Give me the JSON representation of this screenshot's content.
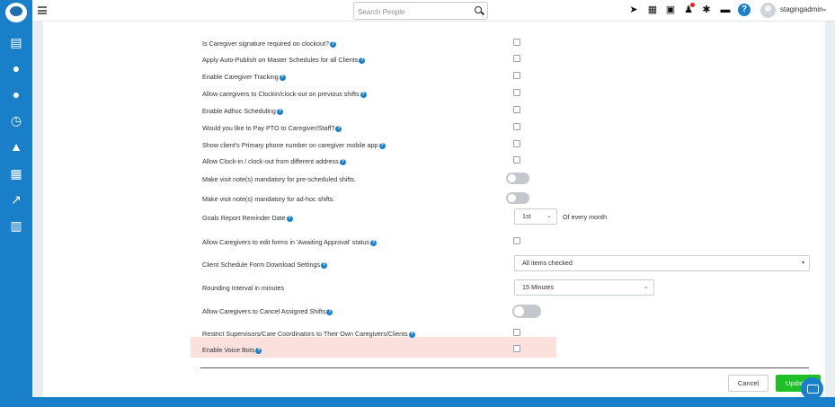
{
  "search": {
    "placeholder": "Search People"
  },
  "header": {
    "username": "stagingadmin",
    "icons": [
      "rocket-icon",
      "calendar-icon",
      "document-icon",
      "bell-icon",
      "gear-icon",
      "chat-bubble-icon",
      "help-icon"
    ]
  },
  "sidebar": {
    "icons": [
      "dashboard-icon",
      "caregiver-icon",
      "client-icon",
      "clock-icon",
      "team-icon",
      "report-icon",
      "chart-icon",
      "billing-icon"
    ]
  },
  "settings": {
    "rows": [
      {
        "label": "Is Caregiver signature required on clockout?",
        "control": "checkbox"
      },
      {
        "label": "Apply Auto-Publish on Master Schedules for all Clients",
        "control": "checkbox"
      },
      {
        "label": "Enable Caregiver Tracking",
        "control": "checkbox"
      },
      {
        "label": "Allow caregivers to Clockin/clock-out on previous shifts",
        "control": "checkbox"
      },
      {
        "label": "Enable Adhoc Scheduling",
        "control": "checkbox"
      },
      {
        "label": "Would you like to Pay PTO to Caregiver/Staff?",
        "control": "checkbox"
      },
      {
        "label": "Show client's Primary phone number on caregiver mobile app",
        "control": "checkbox"
      },
      {
        "label": "Allow Clock-in / clock-out from different address",
        "control": "checkbox"
      },
      {
        "label": "Make visit note(s) mandatory for pre-scheduled shifts.",
        "control": "toggle"
      },
      {
        "label": "Make visit note(s) mandatory for ad-hoc shifts.",
        "control": "toggle"
      },
      {
        "label": "Goals Report Reminder Date",
        "control": "select"
      },
      {
        "label": "Allow Caregivers to edit forms in 'Awaiting Approval' status",
        "control": "checkbox"
      },
      {
        "label": "Client Schedule Form Download Settings",
        "control": "select"
      },
      {
        "label": "Rounding Interval in minutes",
        "control": "select"
      },
      {
        "label": "Allow Caregivers to Cancel Assigned Shifts",
        "control": "toggle"
      },
      {
        "label": "Restrict Supervisors/Care Coordinators to Their Own Caregivers/Clients",
        "control": "checkbox"
      },
      {
        "label": "Enable Voice Bots",
        "control": "checkbox"
      }
    ],
    "goals_day": "1st",
    "goals_suffix": "Of every month",
    "download_settings_value": "All items checked",
    "rounding_value": "15 Minutes"
  },
  "footer": {
    "cancel_label": "Cancel",
    "update_label": "Update"
  },
  "colors": {
    "primary": "#1a7fc9",
    "success": "#1fbf27",
    "highlight": "#fbe1dd"
  }
}
